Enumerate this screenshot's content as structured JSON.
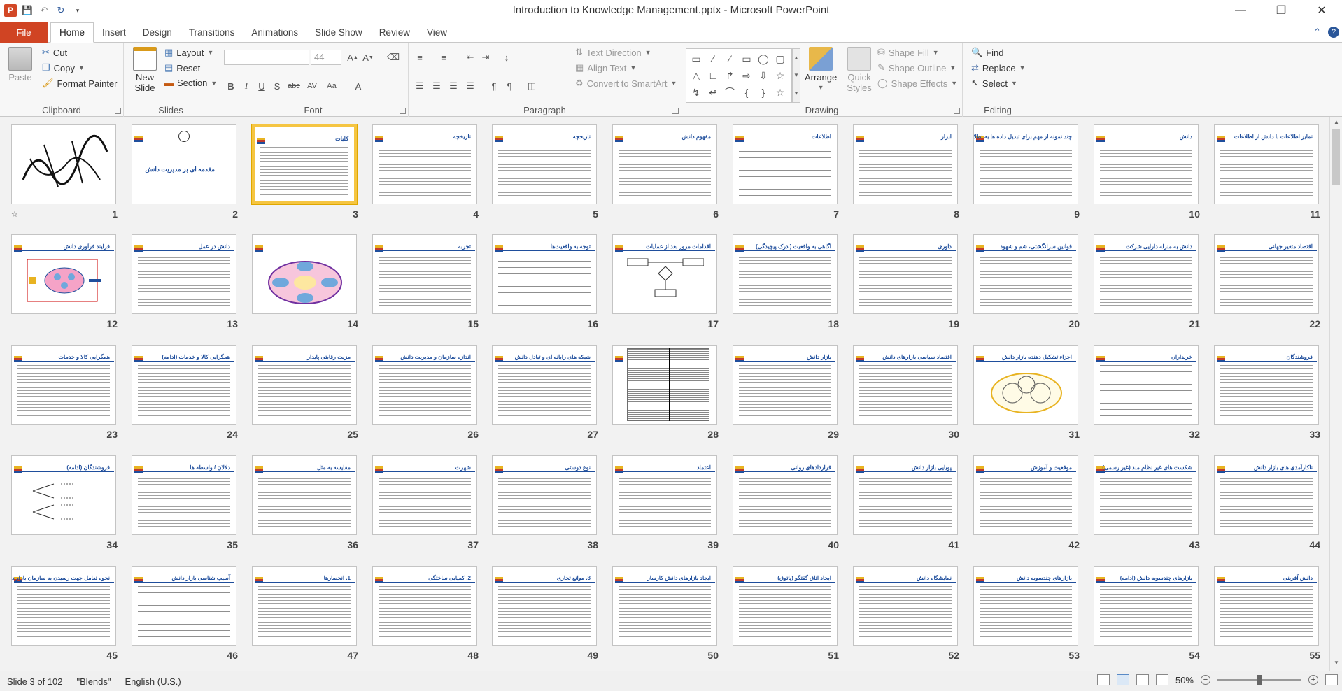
{
  "window": {
    "title": "Introduction to Knowledge Management.pptx  -  Microsoft PowerPoint",
    "qat_icons": [
      "powerpoint-logo",
      "save-icon",
      "undo-icon",
      "redo-icon",
      "customize-qat-icon"
    ]
  },
  "tabs": {
    "file": "File",
    "items": [
      "Home",
      "Insert",
      "Design",
      "Transitions",
      "Animations",
      "Slide Show",
      "Review",
      "View"
    ],
    "active": "Home"
  },
  "ribbon": {
    "clipboard": {
      "label": "Clipboard",
      "paste": "Paste",
      "cut": "Cut",
      "copy": "Copy",
      "format_painter": "Format Painter"
    },
    "slides": {
      "label": "Slides",
      "new_slide": "New Slide",
      "layout": "Layout",
      "reset": "Reset",
      "section": "Section"
    },
    "font": {
      "label": "Font",
      "font_name": "",
      "font_size": "44"
    },
    "paragraph": {
      "label": "Paragraph",
      "text_direction": "Text Direction",
      "align_text": "Align Text",
      "convert_smartart": "Convert to SmartArt"
    },
    "drawing": {
      "label": "Drawing",
      "arrange": "Arrange",
      "quick_styles": "Quick Styles",
      "shape_fill": "Shape Fill",
      "shape_outline": "Shape Outline",
      "shape_effects": "Shape Effects"
    },
    "editing": {
      "label": "Editing",
      "find": "Find",
      "replace": "Replace",
      "select": "Select"
    }
  },
  "slides": [
    {
      "n": "1",
      "title": "",
      "kind": "calligraphy"
    },
    {
      "n": "2",
      "title": "مقدمه ای بر مدیریت دانش",
      "kind": "titleslide"
    },
    {
      "n": "3",
      "title": "کلیات",
      "kind": "text"
    },
    {
      "n": "4",
      "title": "تاریخچه",
      "kind": "text"
    },
    {
      "n": "5",
      "title": "تاریخچه",
      "kind": "text"
    },
    {
      "n": "6",
      "title": "مفهوم دانش",
      "kind": "text"
    },
    {
      "n": "7",
      "title": "اطلاعات",
      "kind": "sparse"
    },
    {
      "n": "8",
      "title": "ابزار",
      "kind": "text"
    },
    {
      "n": "9",
      "title": "چند نمونه از مهم برای تبدیل داده ها به اطلاعات",
      "kind": "text"
    },
    {
      "n": "10",
      "title": "دانش",
      "kind": "text"
    },
    {
      "n": "11",
      "title": "تمایز اطلاعات با دانش از اطلاعات",
      "kind": "text"
    },
    {
      "n": "12",
      "title": "فرایند فرآوری دانش",
      "kind": "diagram"
    },
    {
      "n": "13",
      "title": "دانش در عمل",
      "kind": "text"
    },
    {
      "n": "14",
      "title": "",
      "kind": "oval"
    },
    {
      "n": "15",
      "title": "تجربه",
      "kind": "text"
    },
    {
      "n": "16",
      "title": "توجه به واقعیت‌ها",
      "kind": "sparse"
    },
    {
      "n": "17",
      "title": "اقدامات مرور بعد از عملیات",
      "kind": "flow"
    },
    {
      "n": "18",
      "title": "آگاهی به واقعیت ( درک پیچیدگی)",
      "kind": "text"
    },
    {
      "n": "19",
      "title": "داوری",
      "kind": "text"
    },
    {
      "n": "20",
      "title": "قوانین سرانگشتی، شم و شهود",
      "kind": "text"
    },
    {
      "n": "21",
      "title": "دانش به منزله دارایی شرکت",
      "kind": "text"
    },
    {
      "n": "22",
      "title": "اقتصاد متغیر جهانی",
      "kind": "text"
    },
    {
      "n": "23",
      "title": "همگرایی کالا و خدمات",
      "kind": "text"
    },
    {
      "n": "24",
      "title": "همگرایی کالا و خدمات (ادامه)",
      "kind": "text"
    },
    {
      "n": "25",
      "title": "مزیت رقابتی پایدار",
      "kind": "text"
    },
    {
      "n": "26",
      "title": "اندازه سازمان و مدیریت دانش",
      "kind": "text"
    },
    {
      "n": "27",
      "title": "شبکه های رایانه ای و تبادل دانش",
      "kind": "text"
    },
    {
      "n": "28",
      "title": "",
      "kind": "table"
    },
    {
      "n": "29",
      "title": "بازار دانش",
      "kind": "text"
    },
    {
      "n": "30",
      "title": "اقتصاد سیاسی بازارهای دانش",
      "kind": "text"
    },
    {
      "n": "31",
      "title": "اجزاء تشکیل دهنده بازار دانش",
      "kind": "oval2"
    },
    {
      "n": "32",
      "title": "خریداران",
      "kind": "sparse"
    },
    {
      "n": "33",
      "title": "فروشندگان",
      "kind": "text"
    },
    {
      "n": "34",
      "title": "فروشندگان (ادامه)",
      "kind": "tree"
    },
    {
      "n": "35",
      "title": "دلالان / واسطه ها",
      "kind": "text"
    },
    {
      "n": "36",
      "title": "مقایسه به مثل",
      "kind": "text"
    },
    {
      "n": "37",
      "title": "شهرت",
      "kind": "text"
    },
    {
      "n": "38",
      "title": "نوع دوستی",
      "kind": "text"
    },
    {
      "n": "39",
      "title": "اعتماد",
      "kind": "text"
    },
    {
      "n": "40",
      "title": "قراردادهای روانی",
      "kind": "text"
    },
    {
      "n": "41",
      "title": "پویایی بازار دانش",
      "kind": "text"
    },
    {
      "n": "42",
      "title": "موقعیت و آموزش",
      "kind": "text"
    },
    {
      "n": "43",
      "title": "شکست های غیر نظام مند (غیر رسمی)",
      "kind": "text"
    },
    {
      "n": "44",
      "title": "ناکارآمدی های بازار دانش",
      "kind": "text"
    },
    {
      "n": "45",
      "title": "نحوه تعامل جهت رسیدن به سازمان بازار دانش",
      "kind": "text"
    },
    {
      "n": "46",
      "title": "آسیب شناسی بازار دانش",
      "kind": "sparse"
    },
    {
      "n": "47",
      "title": "1. انحصارها",
      "kind": "text"
    },
    {
      "n": "48",
      "title": "2. کمیابی ساختگی",
      "kind": "text"
    },
    {
      "n": "49",
      "title": "3. موانع تجاری",
      "kind": "text"
    },
    {
      "n": "50",
      "title": "ایجاد بازارهای دانش کارساز",
      "kind": "text"
    },
    {
      "n": "51",
      "title": "ایجاد اتاق گفتگو (پاتوق)",
      "kind": "text"
    },
    {
      "n": "52",
      "title": "نمایشگاه دانش",
      "kind": "text"
    },
    {
      "n": "53",
      "title": "بازارهای چندسویه دانش",
      "kind": "text"
    },
    {
      "n": "54",
      "title": "بازارهای چندسویه دانش (ادامه)",
      "kind": "text"
    },
    {
      "n": "55",
      "title": "دانش آفرینی",
      "kind": "text"
    }
  ],
  "selected_slide": "3",
  "status": {
    "slide_info": "Slide 3 of 102",
    "theme": "\"Blends\"",
    "language": "English (U.S.)",
    "zoom": "50%"
  },
  "colors": {
    "file_tab": "#d04423",
    "accent": "#2b579a",
    "selection": "#f5c542",
    "slide_title": "#1f4e9c"
  }
}
